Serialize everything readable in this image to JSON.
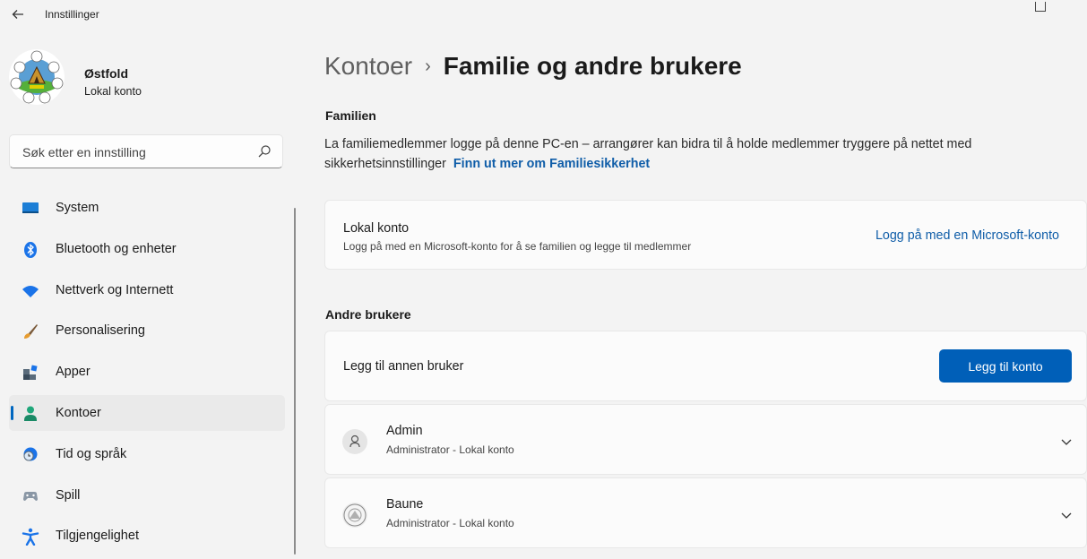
{
  "window": {
    "title": "Innstillinger",
    "back_icon": "back-arrow-icon"
  },
  "profile": {
    "name": "Østfold",
    "account_type": "Lokal konto"
  },
  "search": {
    "placeholder": "Søk etter en innstilling"
  },
  "nav": {
    "items": [
      {
        "label": "System",
        "icon": "monitor-icon"
      },
      {
        "label": "Bluetooth og enheter",
        "icon": "bluetooth-icon"
      },
      {
        "label": "Nettverk og Internett",
        "icon": "wifi-icon"
      },
      {
        "label": "Personalisering",
        "icon": "brush-icon"
      },
      {
        "label": "Apper",
        "icon": "apps-icon"
      },
      {
        "label": "Kontoer",
        "icon": "person-icon",
        "selected": true
      },
      {
        "label": "Tid og språk",
        "icon": "globe-clock-icon"
      },
      {
        "label": "Spill",
        "icon": "gamepad-icon"
      },
      {
        "label": "Tilgjengelighet",
        "icon": "accessibility-icon"
      }
    ]
  },
  "breadcrumb": {
    "parent": "Kontoer",
    "separator": "›",
    "current": "Familie og andre brukere"
  },
  "family": {
    "heading": "Familien",
    "description": "La familiemedlemmer logge på denne PC-en – arrangører kan bidra til å holde medlemmer tryggere på nettet med sikkerhetsinnstillinger",
    "link": "Finn ut mer om Familiesikkerhet"
  },
  "local_account_card": {
    "title": "Lokal konto",
    "subtitle": "Logg på med en Microsoft-konto for å se familien og legge til medlemmer",
    "action": "Logg på med en Microsoft-konto"
  },
  "other_users": {
    "heading": "Andre brukere",
    "add_label": "Legg til annen bruker",
    "add_button": "Legg til konto",
    "users": [
      {
        "name": "Admin",
        "role": "Administrator - Lokal konto"
      },
      {
        "name": "Baune",
        "role": "Administrator - Lokal konto"
      }
    ]
  },
  "colors": {
    "accent": "#005fb8",
    "link": "#0f5da8",
    "background": "#f3f3f3",
    "card": "#fbfbfb"
  }
}
